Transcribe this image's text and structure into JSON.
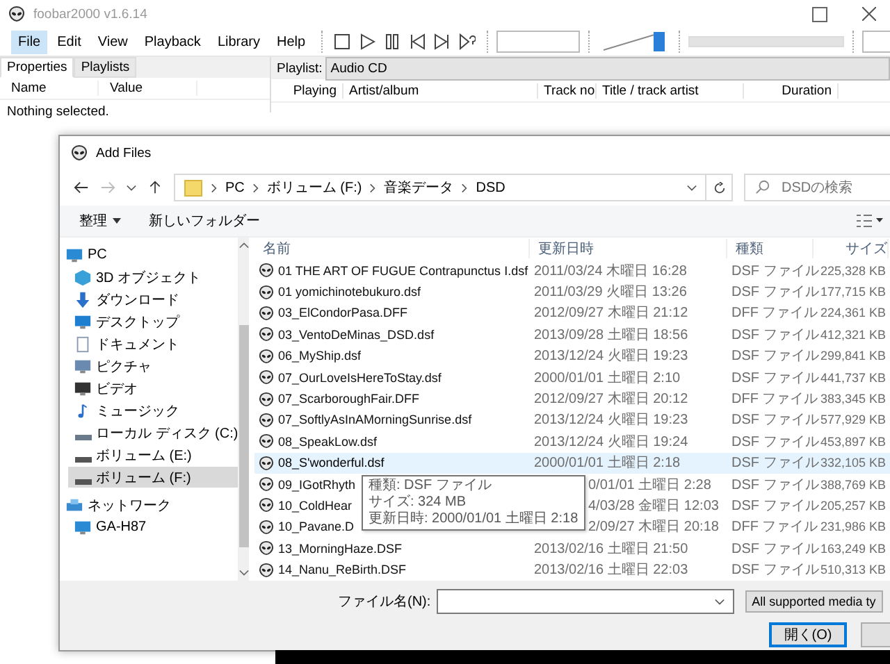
{
  "app": {
    "title": "foobar2000 v1.6.14",
    "menu": [
      {
        "label": "File",
        "selected": true
      },
      {
        "label": "Edit",
        "selected": false
      },
      {
        "label": "View",
        "selected": false
      },
      {
        "label": "Playback",
        "selected": false
      },
      {
        "label": "Library",
        "selected": false
      },
      {
        "label": "Help",
        "selected": false
      }
    ],
    "volume": {
      "level": 1
    },
    "left_tabs": [
      {
        "label": "Properties",
        "selected": true
      },
      {
        "label": "Playlists",
        "selected": false
      }
    ],
    "property_columns": [
      "Name",
      "Value"
    ],
    "properties_empty": "Nothing selected.",
    "playlist_label": "Playlist:",
    "playlist_tabs": [
      {
        "label": "Audio CD",
        "selected": true
      }
    ],
    "playlist_columns": [
      "Playing",
      "Artist/album",
      "Track no",
      "Title / track artist",
      "Duration"
    ]
  },
  "dialog": {
    "title": "Add Files",
    "breadcrumb": [
      "PC",
      "ボリューム (F:)",
      "音楽データ",
      "DSD"
    ],
    "search": {
      "placeholder": "DSDの検索"
    },
    "organize": "整理",
    "new_folder": "新しいフォルダー",
    "nav": [
      {
        "label": "PC",
        "kind": "pc",
        "selected": false,
        "children": [
          {
            "label": "3D オブジェクト",
            "kind": "cube",
            "selected": false
          },
          {
            "label": "ダウンロード",
            "kind": "download",
            "selected": false
          },
          {
            "label": "デスクトップ",
            "kind": "desktop",
            "selected": false
          },
          {
            "label": "ドキュメント",
            "kind": "document",
            "selected": false
          },
          {
            "label": "ピクチャ",
            "kind": "picture",
            "selected": false
          },
          {
            "label": "ビデオ",
            "kind": "video",
            "selected": false
          },
          {
            "label": "ミュージック",
            "kind": "music",
            "selected": false
          },
          {
            "label": "ローカル ディスク (C:)",
            "kind": "disk",
            "selected": false
          },
          {
            "label": "ボリューム (E:)",
            "kind": "drive",
            "selected": false
          },
          {
            "label": "ボリューム (F:)",
            "kind": "drive",
            "selected": true
          }
        ]
      },
      {
        "label": "ネットワーク",
        "kind": "network",
        "selected": false,
        "children": [
          {
            "label": "GA-H87",
            "kind": "pc",
            "selected": false
          }
        ]
      }
    ],
    "columns": [
      "名前",
      "更新日時",
      "種類",
      "サイズ"
    ],
    "files": [
      {
        "name": "01 THE ART OF FUGUE Contrapunctus I.dsf",
        "date": "2011/03/24 木曜日 16:28",
        "type": "DSF ファイル",
        "size": "225,328 KB",
        "selected": false
      },
      {
        "name": "01 yomichinotebukuro.dsf",
        "date": "2011/03/29 火曜日 13:26",
        "type": "DSF ファイル",
        "size": "177,715 KB",
        "selected": false
      },
      {
        "name": "03_ElCondorPasa.DFF",
        "date": "2012/09/27 木曜日 21:12",
        "type": "DFF ファイル",
        "size": "224,361 KB",
        "selected": false
      },
      {
        "name": "03_VentoDeMinas_DSD.dsf",
        "date": "2013/09/28 土曜日 18:56",
        "type": "DSF ファイル",
        "size": "412,321 KB",
        "selected": false
      },
      {
        "name": "06_MyShip.dsf",
        "date": "2013/12/24 火曜日 19:23",
        "type": "DSF ファイル",
        "size": "299,841 KB",
        "selected": false
      },
      {
        "name": "07_OurLoveIsHereToStay.dsf",
        "date": "2000/01/01 土曜日 2:10",
        "type": "DSF ファイル",
        "size": "441,737 KB",
        "selected": false
      },
      {
        "name": "07_ScarboroughFair.DFF",
        "date": "2012/09/27 木曜日 20:12",
        "type": "DFF ファイル",
        "size": "383,345 KB",
        "selected": false
      },
      {
        "name": "07_SoftlyAsInAMorningSunrise.dsf",
        "date": "2013/12/24 火曜日 19:23",
        "type": "DSF ファイル",
        "size": "577,929 KB",
        "selected": false
      },
      {
        "name": "08_SpeakLow.dsf",
        "date": "2013/12/24 火曜日 19:24",
        "type": "DSF ファイル",
        "size": "453,897 KB",
        "selected": false
      },
      {
        "name": "08_S'wonderful.dsf",
        "date": "2000/01/01 土曜日 2:18",
        "type": "DSF ファイル",
        "size": "332,105 KB",
        "selected": true
      },
      {
        "name": "09_IGotRhyth",
        "date": "0/01/01 土曜日 2:28",
        "type": "DSF ファイル",
        "size": "388,769 KB",
        "selected": false
      },
      {
        "name": "10_ColdHear",
        "date": "4/03/28 金曜日 12:03",
        "type": "DSF ファイル",
        "size": "205,257 KB",
        "selected": false
      },
      {
        "name": "10_Pavane.D",
        "date": "2/09/27 木曜日 20:18",
        "type": "DFF ファイル",
        "size": "231,986 KB",
        "selected": false
      },
      {
        "name": "13_MorningHaze.DSF",
        "date": "2013/02/16 土曜日 21:50",
        "type": "DSF ファイル",
        "size": "163,249 KB",
        "selected": false
      },
      {
        "name": "14_Nanu_ReBirth.DSF",
        "date": "2013/02/16 土曜日 22:03",
        "type": "DSF ファイル",
        "size": "510,313 KB",
        "selected": false
      }
    ],
    "tooltip": [
      "種類: DSF ファイル",
      "サイズ: 324 MB",
      "更新日時: 2000/01/01 土曜日 2:18"
    ],
    "filename_label": "ファイル名(N):",
    "filetype": "All supported media ty",
    "open_button": "開く(O)"
  }
}
